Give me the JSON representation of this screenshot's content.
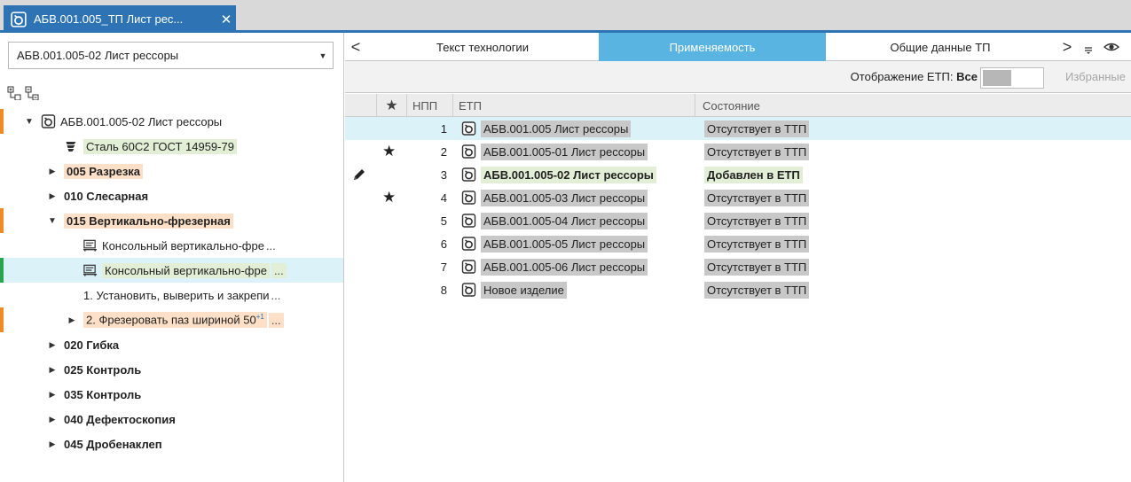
{
  "doc_tab": {
    "title": "АБВ.001.005_ТП Лист рес...",
    "close": "✕",
    "icon": "product-icon"
  },
  "left": {
    "combo_value": "АБВ.001.005-02 Лист рессоры",
    "tree": [
      {
        "label": "АБВ.001.005-02 Лист рессоры"
      },
      {
        "label": "Сталь 60С2 ГОСТ 14959-79"
      },
      {
        "label": "005 Разрезка"
      },
      {
        "label": "010 Слесарная"
      },
      {
        "label": "015 Вертикально-фрезерная"
      },
      {
        "label": "Консольный вертикально-фре",
        "suffix": "..."
      },
      {
        "label": "Консольный вертикально-фре",
        "suffix": "..."
      },
      {
        "label": "1. Установить, выверить и закрепи",
        "suffix": "..."
      },
      {
        "label": "2. Фрезеровать паз шириной 50",
        "sup": "+1",
        "suffix": "..."
      },
      {
        "label": "020 Гибка"
      },
      {
        "label": "025 Контроль"
      },
      {
        "label": "035 Контроль"
      },
      {
        "label": "040 Дефектоскопия"
      },
      {
        "label": "045 Дробенаклеп"
      }
    ]
  },
  "right": {
    "tabs": [
      "Текст технологии",
      "Применяемость",
      "Общие данные ТП"
    ],
    "active_tab": "Применяемость",
    "nav_prev": "<",
    "nav_next": ">",
    "filter": {
      "label": "Отображение ЕТП:",
      "value": "Все",
      "favorites": "Избранные"
    },
    "columns": {
      "star": "★",
      "npp": "НПП",
      "etp": "ЕТП",
      "state": "Состояние"
    },
    "rows": [
      {
        "npp": "1",
        "star": "",
        "etp": "АБВ.001.005 Лист рессоры",
        "state": "Отсутствует в ТТП"
      },
      {
        "npp": "2",
        "star": "★",
        "etp": "АБВ.001.005-01 Лист рессоры",
        "state": "Отсутствует в ТТП"
      },
      {
        "npp": "3",
        "star": "",
        "etp": "АБВ.001.005-02 Лист рессоры",
        "state": "Добавлен в ЕТП"
      },
      {
        "npp": "4",
        "star": "★",
        "etp": "АБВ.001.005-03 Лист рессоры",
        "state": "Отсутствует в ТТП"
      },
      {
        "npp": "5",
        "star": "",
        "etp": "АБВ.001.005-04 Лист рессоры",
        "state": "Отсутствует в ТТП"
      },
      {
        "npp": "6",
        "star": "",
        "etp": "АБВ.001.005-05 Лист рессоры",
        "state": "Отсутствует в ТТП"
      },
      {
        "npp": "7",
        "star": "",
        "etp": "АБВ.001.005-06 Лист рессоры",
        "state": "Отсутствует в ТТП"
      },
      {
        "npp": "8",
        "star": "",
        "etp": "Новое изделие",
        "state": "Отсутствует в ТТП"
      }
    ]
  },
  "colors": {
    "accent": "#2e74b5",
    "active_tab": "#5ab4e1",
    "selection": "#daf2f8",
    "orange_mark": "#f08a24",
    "green_mark": "#2aa44f"
  }
}
